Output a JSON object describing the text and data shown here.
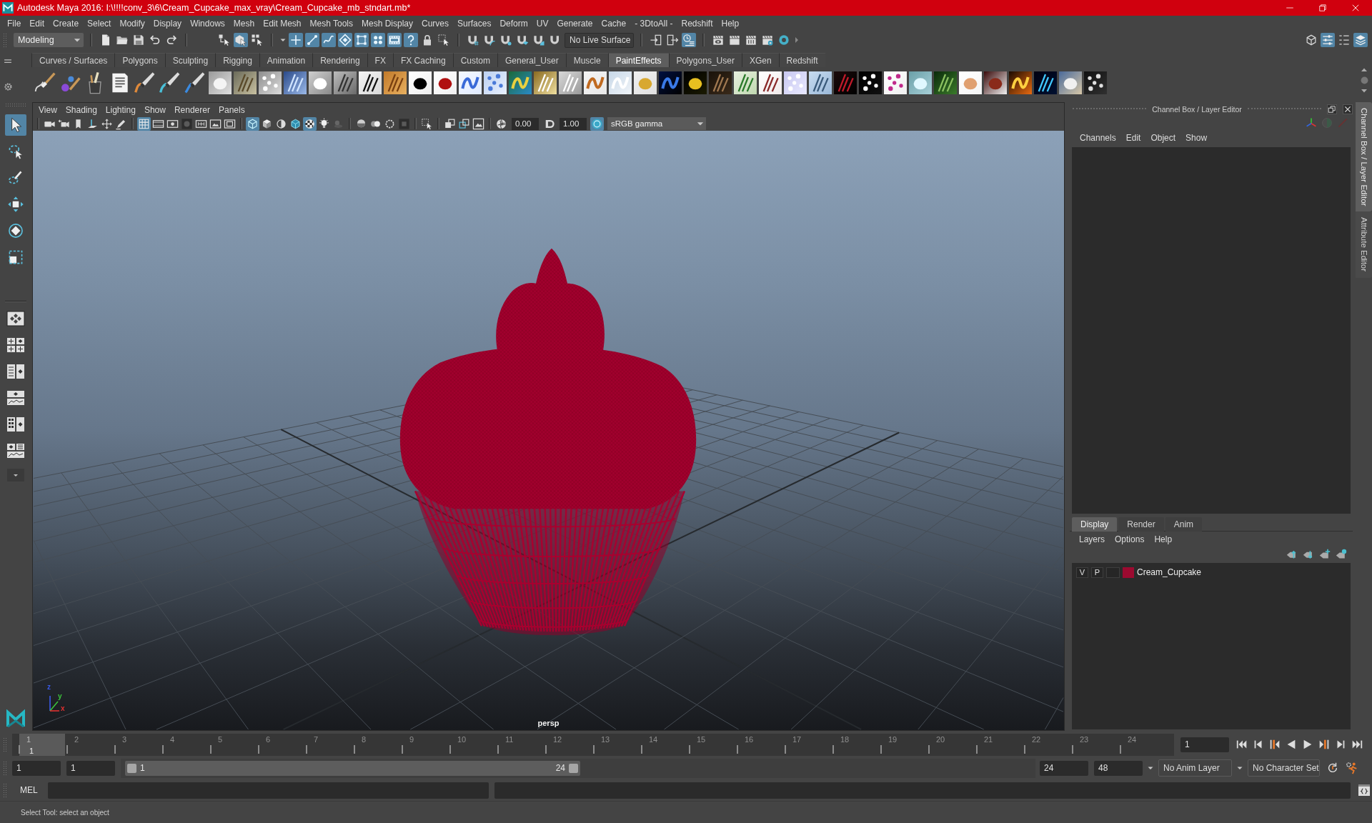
{
  "window": {
    "title": "Autodesk Maya 2016: I:\\!!!!conv_3\\6\\Cream_Cupcake_max_vray\\Cream_Cupcake_mb_stndart.mb*"
  },
  "menu_bar": [
    "File",
    "Edit",
    "Create",
    "Select",
    "Modify",
    "Display",
    "Windows",
    "Mesh",
    "Edit Mesh",
    "Mesh Tools",
    "Mesh Display",
    "Curves",
    "Surfaces",
    "Deform",
    "UV",
    "Generate",
    "Cache",
    "- 3DtoAll -",
    "Redshift",
    "Help"
  ],
  "status_line": {
    "mode": "Modeling",
    "live_surface": "No Live Surface",
    "tools": [
      {
        "on": false
      },
      {
        "on": false
      },
      {
        "on": false
      },
      {
        "on": false
      },
      {
        "on": false
      },
      {
        "on": false
      },
      {
        "on": true
      },
      {
        "on": false
      },
      {
        "on": true
      },
      {
        "on": true
      },
      {
        "on": true
      },
      {
        "on": true
      },
      {
        "on": true
      },
      {
        "on": true
      },
      {
        "on": true
      },
      {
        "on": true
      },
      {
        "on": false
      },
      {
        "on": false
      },
      {
        "on": false
      },
      {
        "on": false
      },
      {
        "on": false
      },
      {
        "on": false
      },
      {
        "on": false
      },
      {
        "on": false
      },
      {
        "on": false
      },
      {
        "on": false
      },
      {
        "on": true
      },
      {
        "on": false
      },
      {
        "on": false
      },
      {
        "on": false
      },
      {
        "on": false
      },
      {
        "on": false
      },
      {
        "on": false
      },
      {
        "on": true
      },
      {
        "on": false
      },
      {
        "on": true
      }
    ]
  },
  "shelf": {
    "tabs": [
      {
        "label": "Curves / Surfaces",
        "selected": false
      },
      {
        "label": "Polygons",
        "selected": false
      },
      {
        "label": "Sculpting",
        "selected": false
      },
      {
        "label": "Rigging",
        "selected": false
      },
      {
        "label": "Animation",
        "selected": false
      },
      {
        "label": "Rendering",
        "selected": false
      },
      {
        "label": "FX",
        "selected": false
      },
      {
        "label": "FX Caching",
        "selected": false
      },
      {
        "label": "Custom",
        "selected": false
      },
      {
        "label": "General_User",
        "selected": false
      },
      {
        "label": "Muscle",
        "selected": false
      },
      {
        "label": "PaintEffects",
        "selected": true
      },
      {
        "label": "Polygons_User",
        "selected": false
      },
      {
        "label": "XGen",
        "selected": false
      },
      {
        "label": "Redshift",
        "selected": false
      }
    ]
  },
  "toolbox": {
    "tools": [
      {
        "on": true
      },
      {
        "on": false
      },
      {
        "on": false
      },
      {
        "on": false
      },
      {
        "on": false
      },
      {
        "on": false
      }
    ]
  },
  "viewport": {
    "menus": [
      "View",
      "Shading",
      "Lighting",
      "Show",
      "Renderer",
      "Panels"
    ],
    "tools": [
      {
        "on": false
      },
      {
        "on": false
      },
      {
        "on": false
      },
      {
        "on": false
      },
      {
        "on": false
      },
      {
        "on": false
      },
      {
        "on": true
      },
      {
        "on": false
      },
      {
        "on": false
      },
      {
        "on": false
      },
      {
        "on": false
      },
      {
        "on": false
      },
      {
        "on": false
      },
      {
        "on": true
      },
      {
        "on": false
      },
      {
        "on": false
      },
      {
        "on": false
      },
      {
        "on": true
      },
      {
        "on": false
      },
      {
        "on": false
      },
      {
        "on": false
      },
      {
        "on": false
      },
      {
        "on": false
      },
      {
        "on": false
      },
      {
        "on": false
      },
      {
        "on": false
      },
      {
        "on": false
      },
      {
        "on": false
      },
      {
        "on": false
      },
      {
        "on": false
      },
      {
        "on": true
      }
    ],
    "exposure": "0.00",
    "gamma": "1.00",
    "color_space": "sRGB gamma",
    "axes": [
      {
        "label": "z",
        "color": "#3a5ae8"
      },
      {
        "label": "y",
        "color": "#3cc43c"
      },
      {
        "label": "x",
        "color": "#e03030"
      }
    ],
    "camera_label": "persp"
  },
  "channel_box": {
    "title": "Channel Box / Layer Editor",
    "menus": [
      "Channels",
      "Edit",
      "Object",
      "Show"
    ]
  },
  "layer_editor": {
    "tabs": [
      {
        "label": "Display",
        "selected": true
      },
      {
        "label": "Render",
        "selected": false
      },
      {
        "label": "Anim",
        "selected": false
      }
    ],
    "menus": [
      "Layers",
      "Options",
      "Help"
    ],
    "layers": [
      {
        "visibility": "V",
        "playback": "P",
        "name": "Cream_Cupcake",
        "color": "#9c0a30"
      }
    ]
  },
  "side_tabs": [
    {
      "label": "Channel Box / Layer Editor",
      "selected": true
    },
    {
      "label": "Attribute Editor",
      "selected": false
    }
  ],
  "time_slider": {
    "ticks": [
      {
        "label": "1",
        "current": true
      },
      {
        "label": "2",
        "current": false
      },
      {
        "label": "3",
        "current": false
      },
      {
        "label": "4",
        "current": false
      },
      {
        "label": "5",
        "current": false
      },
      {
        "label": "6",
        "current": false
      },
      {
        "label": "7",
        "current": false
      },
      {
        "label": "8",
        "current": false
      },
      {
        "label": "9",
        "current": false
      },
      {
        "label": "10",
        "current": false
      },
      {
        "label": "11",
        "current": false
      },
      {
        "label": "12",
        "current": false
      },
      {
        "label": "13",
        "current": false
      },
      {
        "label": "14",
        "current": false
      },
      {
        "label": "15",
        "current": false
      },
      {
        "label": "16",
        "current": false
      },
      {
        "label": "17",
        "current": false
      },
      {
        "label": "18",
        "current": false
      },
      {
        "label": "19",
        "current": false
      },
      {
        "label": "20",
        "current": false
      },
      {
        "label": "21",
        "current": false
      },
      {
        "label": "22",
        "current": false
      },
      {
        "label": "23",
        "current": false
      },
      {
        "label": "24",
        "current": false
      }
    ],
    "current_frame": "1",
    "frame_field": "1"
  },
  "range_slider": {
    "animation_start": "1",
    "playback_start": "1",
    "range_start": "1",
    "range_end": "24",
    "level": 0.5,
    "playback_end": "24",
    "animation_end": "48",
    "anim_layer": "No Anim Layer",
    "character_set": "No Character Set"
  },
  "command_line": {
    "language": "MEL"
  },
  "help_line": "Select Tool: select an object"
}
